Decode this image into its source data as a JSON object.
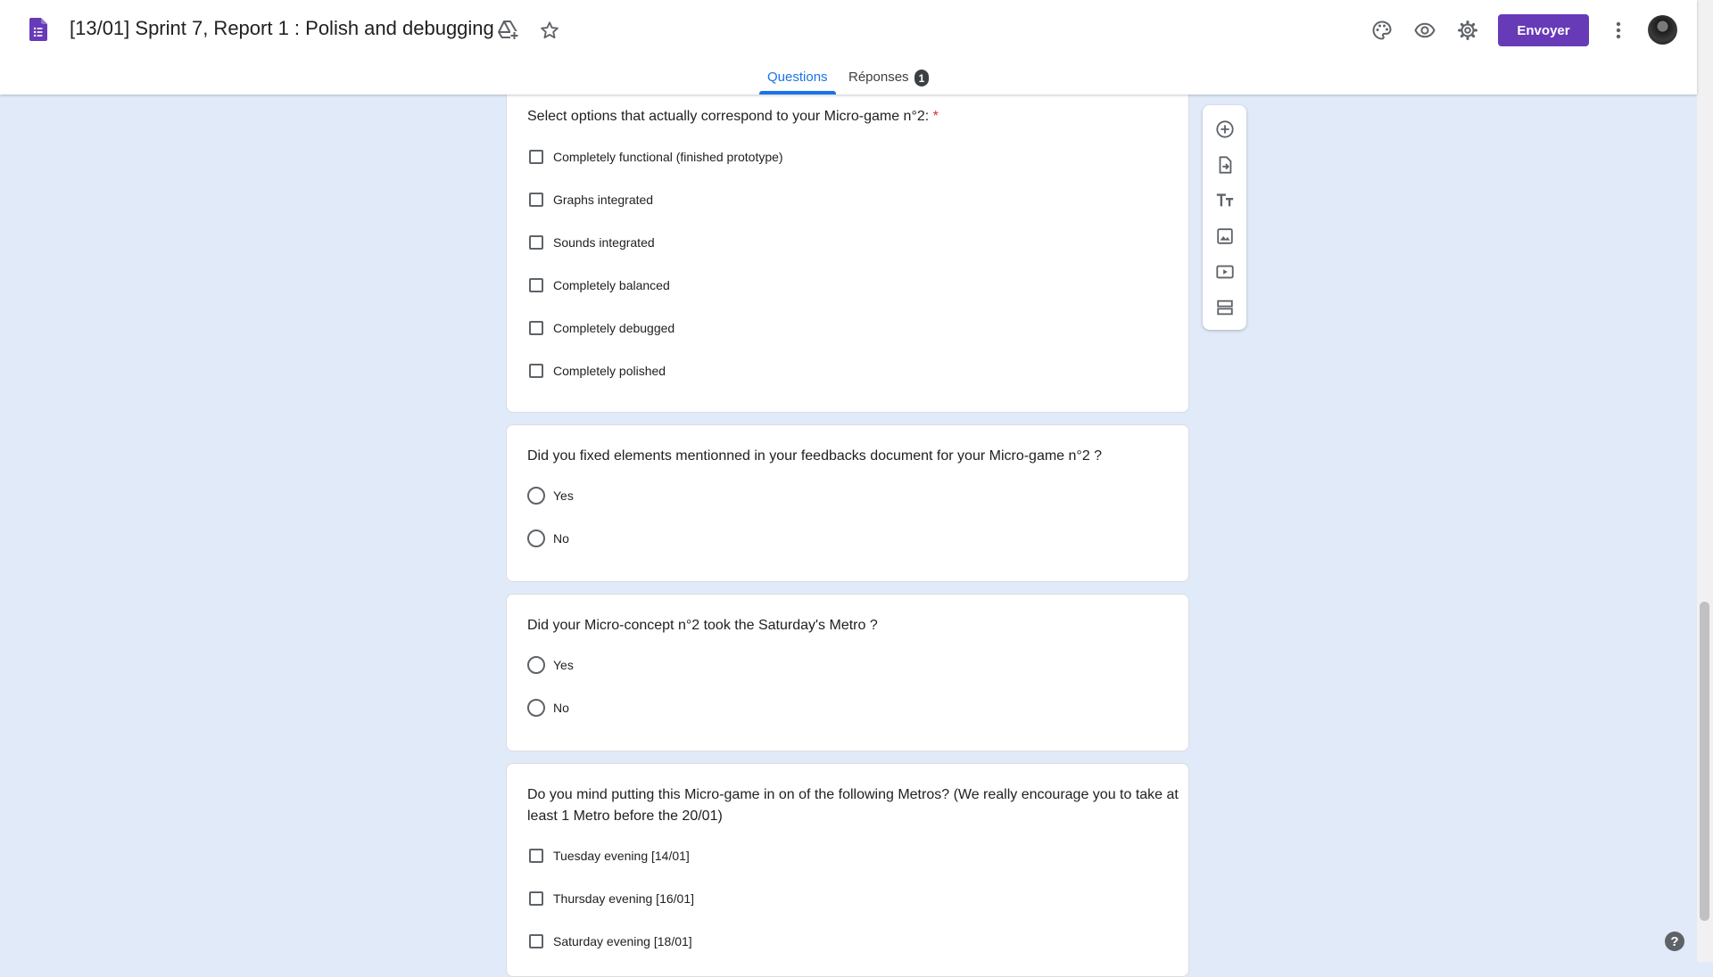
{
  "header": {
    "title": "[13/01] Sprint 7, Report 1 : Polish and debugging",
    "send_label": "Envoyer",
    "icons": [
      "forms-doc-icon",
      "drive-add-icon",
      "star-icon",
      "palette-icon",
      "eye-icon",
      "gear-icon",
      "more-vert-icon",
      "avatar"
    ]
  },
  "tabs": {
    "questions": "Questions",
    "responses": "Réponses",
    "responses_badge": "1"
  },
  "questions": [
    {
      "text": "Select options that actually correspond to your Micro-game n°2:",
      "required_mark": "*",
      "type": "checkbox",
      "options": [
        "Completely functional (finished prototype)",
        "Graphs integrated",
        "Sounds integrated",
        "Completely balanced",
        "Completely debugged",
        "Completely polished"
      ]
    },
    {
      "text": "Did you fixed elements mentionned in your feedbacks document for your Micro-game n°2 ?",
      "type": "radio",
      "options": [
        "Yes",
        "No"
      ]
    },
    {
      "text": "Did your Micro-concept n°2 took the Saturday's Metro ?",
      "type": "radio",
      "options": [
        "Yes",
        "No"
      ]
    },
    {
      "text": "Do you mind putting this Micro-game in on of the following Metros? (We really encourage you to take at least 1 Metro before the 20/01)",
      "type": "checkbox",
      "options": [
        "Tuesday evening [14/01]",
        "Thursday evening [16/01]",
        "Saturday evening [18/01]"
      ]
    }
  ],
  "toolbar": [
    "add-question-icon",
    "import-questions-icon",
    "add-title-icon",
    "add-image-icon",
    "add-video-icon",
    "add-section-icon"
  ],
  "help": "?",
  "colors": {
    "accent": "#673ab7",
    "tab_active": "#1a73e8",
    "background": "#e1eaf9"
  }
}
